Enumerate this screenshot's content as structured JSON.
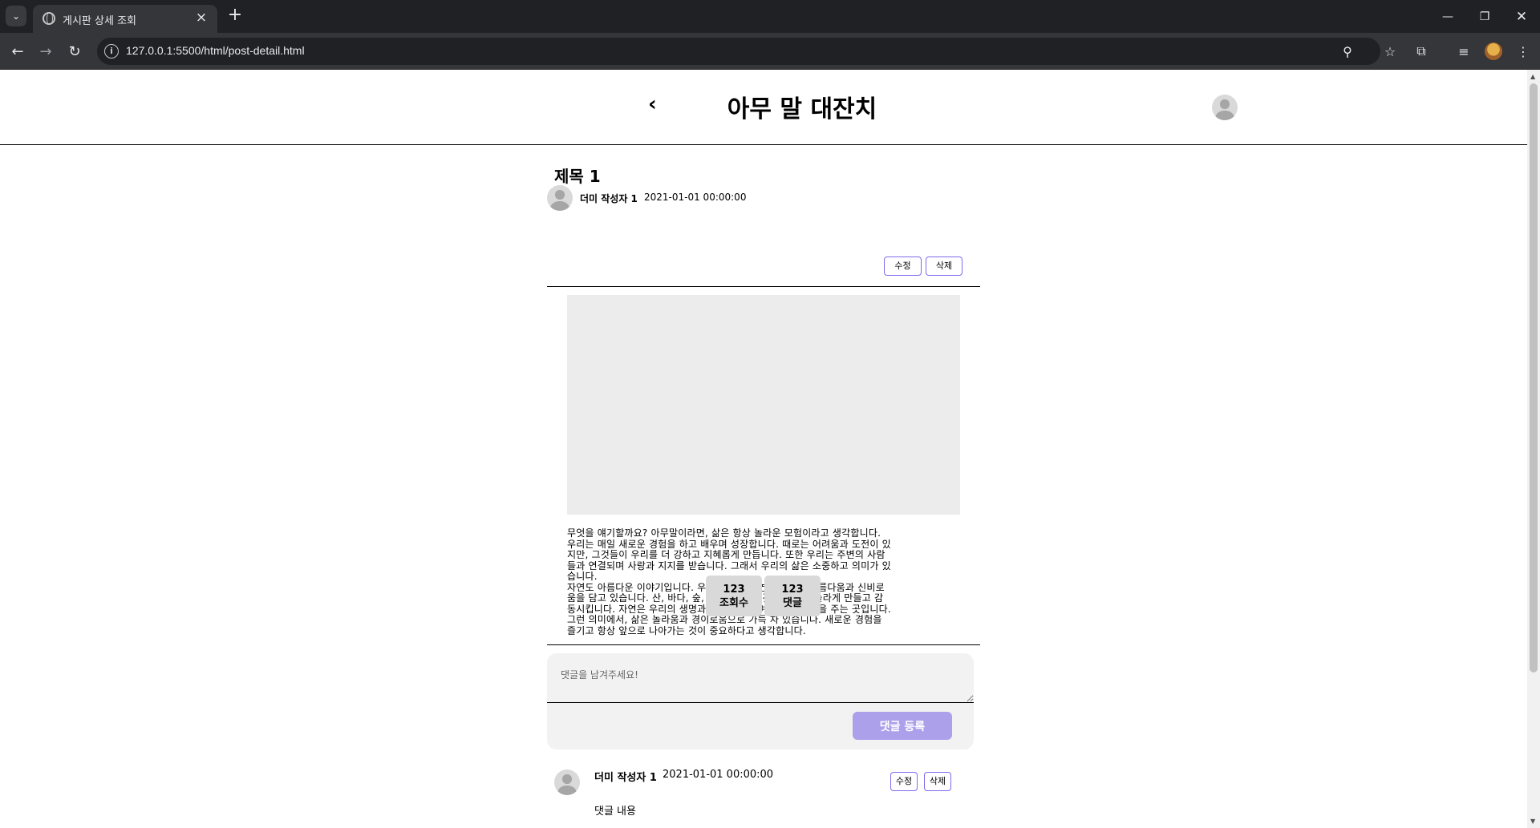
{
  "browser": {
    "tab_title": "게시판 상세 조회",
    "url": "127.0.0.1:5500/html/post-detail.html",
    "icons": {
      "tab_list": "chevron-down-icon",
      "favicon": "globe-icon",
      "tab_close": "close-icon",
      "new_tab": "plus-icon",
      "back": "arrow-left-icon",
      "forward": "arrow-right-icon",
      "reload": "reload-icon",
      "site_info": "info-icon",
      "zoom": "zoom-icon",
      "bookmark": "star-icon",
      "extensions": "puzzle-icon",
      "media": "media-queue-icon",
      "profile": "profile-avatar",
      "menu": "kebab-menu-icon"
    }
  },
  "header": {
    "title": "아무 말 대잔치",
    "back_icon": "chevron-left-icon",
    "profile_icon": "user-avatar-icon"
  },
  "post": {
    "title": "제목 1",
    "author": "더미 작성자 1",
    "date": "2021-01-01 00:00:00",
    "edit_label": "수정",
    "delete_label": "삭제",
    "body": "무엇을 얘기할까요? 아무말이라면, 삶은 항상 놀라운 모험이라고 생각합니다.\n우리는 매일 새로운 경험을 하고 배우며 성장합니다. 때로는 어려움과 도전이 있\n지만, 그것들이 우리를 더 강하고 지혜롭게 만듭니다. 또한 우리는 주변의 사람\n들과 연결되며 사랑과 지지를 받습니다. 그래서 우리의 삶은 소중하고 의미가 있\n습니다.\n자연도 아름다운 이야기입니다. 우리 주변의 자연은 끝없는 아름다움과 신비로\n움을 담고 있습니다. 산, 바다, 숲, 하늘 등 모든 것이 우리를 놀라게 만들고 감\n동시킵니다. 자연은 우리의 생명과 안정을 지키며 우리에게 힘을 주는 곳입니다.\n그런 의미에서, 삶은 놀라움과 경이로움으로 가득 차 있습니다. 새로운 경험을\n즐기고 항상 앞으로 나아가는 것이 중요하다고 생각합니다.",
    "views_count": "123",
    "views_label": "조회수",
    "comments_count": "123",
    "comments_label": "댓글"
  },
  "comment_form": {
    "placeholder": "댓글을 남겨주세요!",
    "submit_label": "댓글 등록",
    "submit_color": "#aca0eb"
  },
  "comments": [
    {
      "author": "더미 작성자 1",
      "date": "2021-01-01 00:00:00",
      "text": "댓글 내용",
      "edit_label": "수정",
      "delete_label": "삭제"
    }
  ],
  "colors": {
    "accent_border": "#7f6aee",
    "image_placeholder": "#ececec",
    "stat_box": "#d9d9d9",
    "comment_box": "#f2f2f2"
  }
}
